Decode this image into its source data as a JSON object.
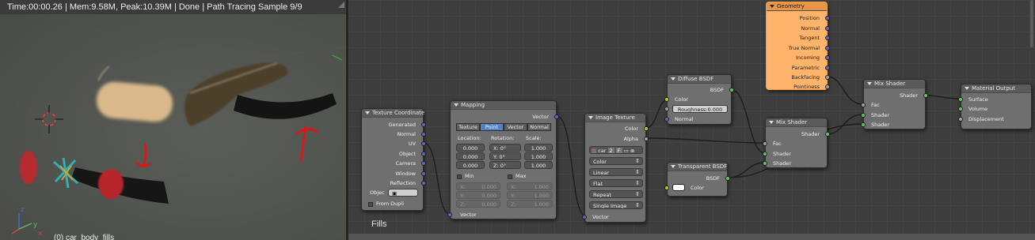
{
  "viewport": {
    "header_text": "Time:00:00.26 | Mem:9.58M, Peak:10.39M | Done | Path Tracing Sample 9/9",
    "object_name": "(0) car_body_fills",
    "axis_labels": {
      "z": "z",
      "y": "y",
      "x": "x"
    }
  },
  "node_editor": {
    "tree_name": "Fills",
    "nodes": {
      "texcoord": {
        "title": "Texture Coordinate",
        "outputs": [
          "Generated",
          "Normal",
          "UV",
          "Object",
          "Camera",
          "Window",
          "Reflection"
        ],
        "object_label": "Objec",
        "from_dupli": "From Dupli"
      },
      "mapping": {
        "title": "Mapping",
        "output": "Vector",
        "tabs": [
          "Texture",
          "Point",
          "Vector",
          "Normal"
        ],
        "active_tab": "Point",
        "location_label": "Location:",
        "rotation_label": "Rotation:",
        "scale_label": "Scale:",
        "location": [
          "0.000",
          "0.000",
          "0.000"
        ],
        "rotation": [
          "X:",
          "0°",
          "Y:",
          "0°",
          "Z:",
          "0°"
        ],
        "scale": [
          "1.000",
          "1.000",
          "1.000"
        ],
        "min_label": "Min",
        "max_label": "Max",
        "min": [
          "X:",
          "0.000",
          "Y:",
          "0.000",
          "Z:",
          "0.000"
        ],
        "max": [
          "X:",
          "1.000",
          "Y:",
          "1.000",
          "Z:",
          "1.000"
        ],
        "input": "Vector"
      },
      "image": {
        "title": "Image Texture",
        "outputs": [
          "Color",
          "Alpha"
        ],
        "image_name": "car",
        "users": "2",
        "fake_user": "F",
        "color_space": "Color",
        "interpolation": "Linear",
        "projection": "Flat",
        "extension": "Repeat",
        "source": "Single Image",
        "input": "Vector"
      },
      "diffuse": {
        "title": "Diffuse BSDF",
        "output": "BSDF",
        "inputs": [
          "Color",
          "Normal"
        ],
        "roughness": "Roughness:0.000"
      },
      "transparent": {
        "title": "Transparent BSDF",
        "output": "BSDF",
        "input": "Color"
      },
      "geometry": {
        "title": "Geometry",
        "outputs": [
          "Position",
          "Normal",
          "Tangent",
          "True Normal",
          "Incoming",
          "Parametric",
          "Backfacing",
          "Pointiness"
        ]
      },
      "mix1": {
        "title": "Mix Shader",
        "output": "Shader",
        "inputs": [
          "Fac",
          "Shader",
          "Shader"
        ]
      },
      "mix2": {
        "title": "Mix Shader",
        "output": "Shader",
        "inputs": [
          "Fac",
          "Shader",
          "Shader"
        ]
      },
      "output": {
        "title": "Material Output",
        "inputs": [
          "Surface",
          "Volume",
          "Displacement"
        ]
      }
    },
    "colors": {
      "selected_outline": "#f1a443",
      "vector_socket": "#6363c7",
      "shader_socket": "#63c763",
      "color_socket": "#c7c729",
      "float_socket": "#a1a1a1"
    }
  }
}
